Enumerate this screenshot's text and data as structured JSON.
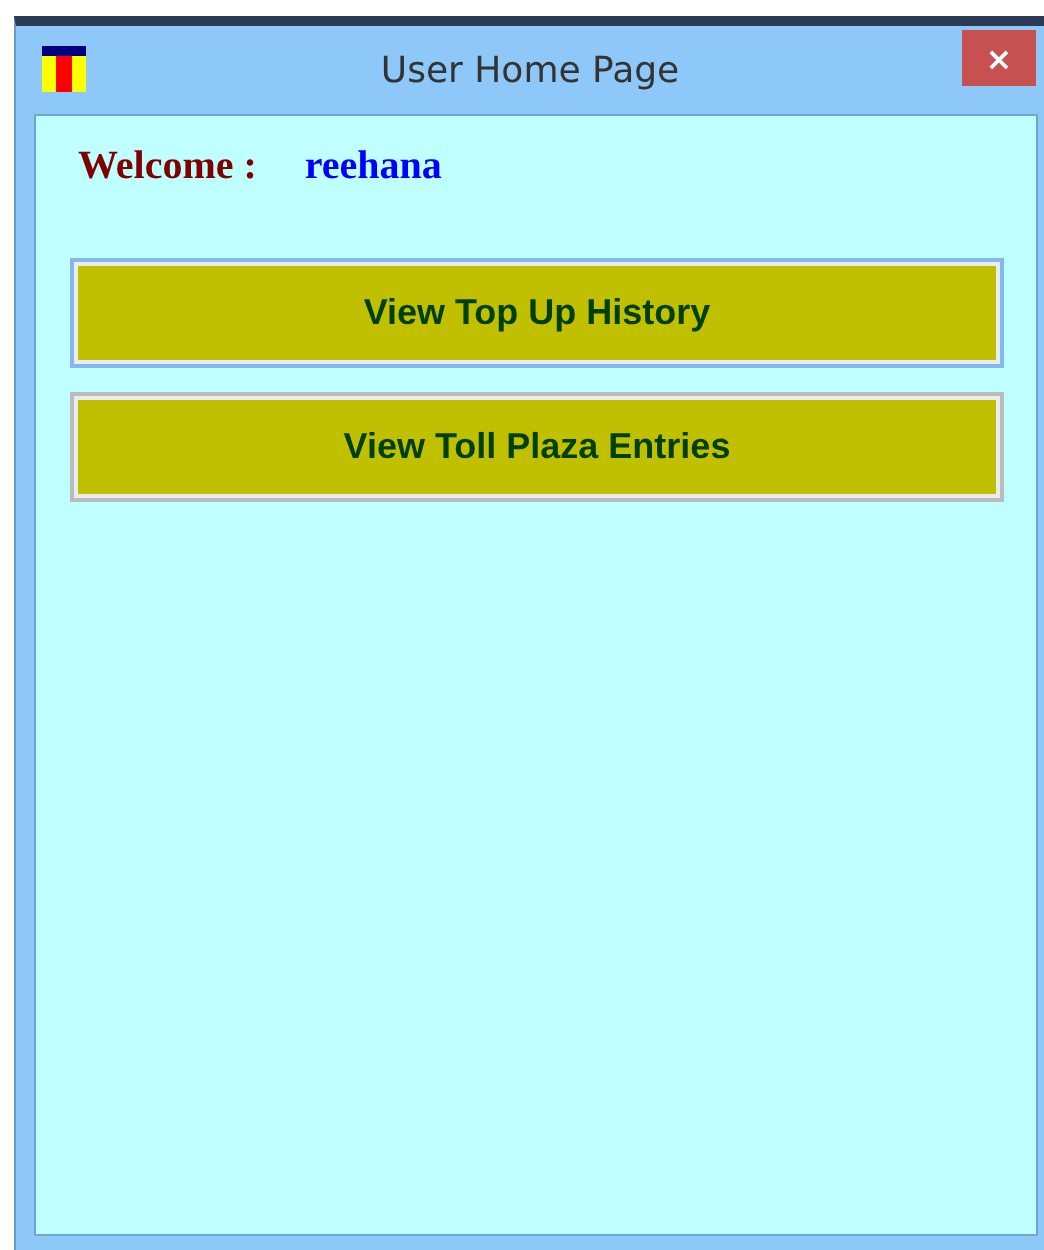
{
  "window": {
    "title": "User Home Page",
    "close": "×"
  },
  "welcome": {
    "label": "Welcome :",
    "user": "reehana"
  },
  "buttons": [
    {
      "label": "View Top Up History",
      "focused": true
    },
    {
      "label": "View Toll Plaza Entries",
      "focused": false
    }
  ]
}
